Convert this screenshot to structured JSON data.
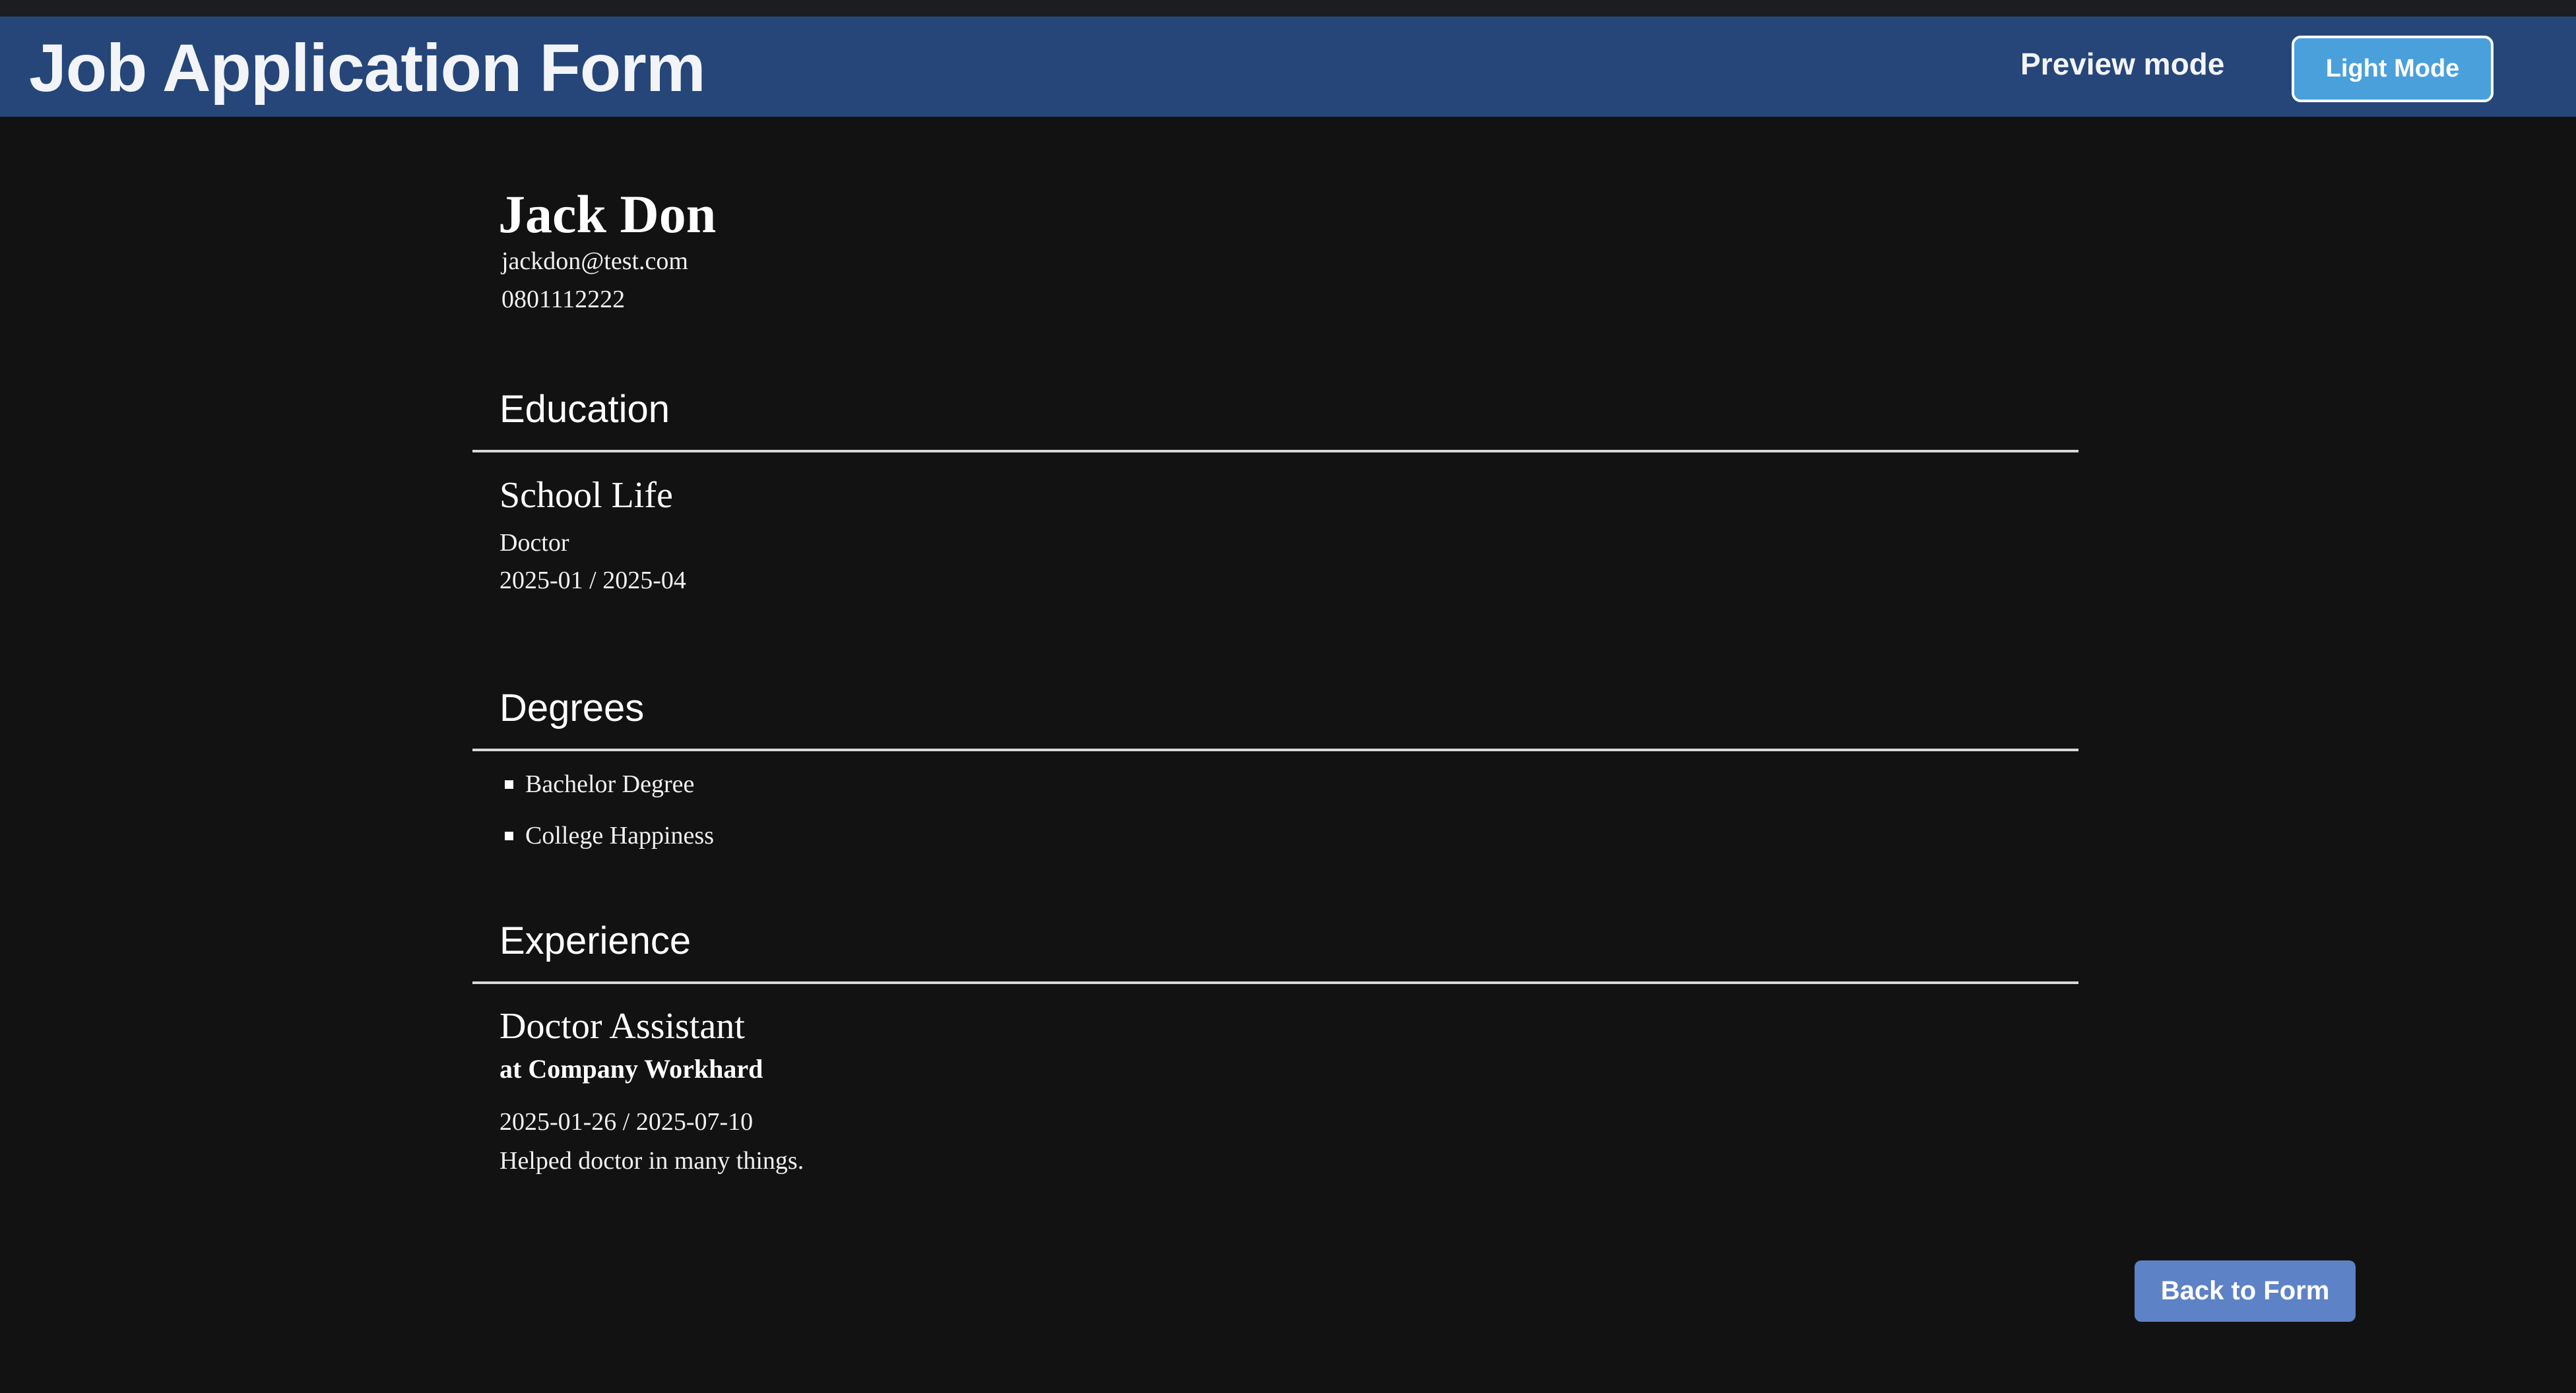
{
  "header": {
    "title": "Job Application Form",
    "mode_label": "Preview mode",
    "theme_toggle_label": "Light Mode"
  },
  "profile": {
    "name": "Jack Don",
    "email": "jackdon@test.com",
    "phone": "0801112222"
  },
  "education": {
    "heading": "Education",
    "items": [
      {
        "school": "School Life",
        "degree": "Doctor",
        "dates": "2025-01 / 2025-04"
      }
    ]
  },
  "degrees": {
    "heading": "Degrees",
    "items": [
      "Bachelor Degree",
      "College Happiness"
    ]
  },
  "experience": {
    "heading": "Experience",
    "items": [
      {
        "role": "Doctor Assistant",
        "company": "at Company Workhard",
        "dates": "2025-01-26 / 2025-07-10",
        "description": "Helped doctor in many things."
      }
    ]
  },
  "actions": {
    "back_label": "Back to Form"
  },
  "colors": {
    "background": "#121212",
    "header": "#264679",
    "theme_button": "#4aa0db",
    "back_button": "#5d82c6"
  }
}
